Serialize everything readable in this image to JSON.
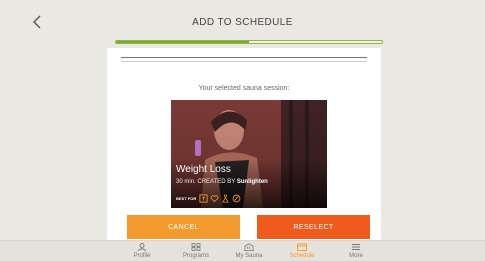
{
  "header": {
    "title": "ADD TO SCHEDULE",
    "progress": 0.5
  },
  "card": {
    "selected_label": "Your selected sauna session:",
    "session": {
      "name": "Weight Loss",
      "duration": "30 min.",
      "created_by_label": "CREATED BY",
      "creator": "Sunlighten",
      "best_for_label": "BEST FOR",
      "best_for_icons": [
        "fitness-icon",
        "heart-icon",
        "body-icon",
        "leaf-icon"
      ]
    }
  },
  "buttons": {
    "cancel": "CANCEL",
    "reselect": "RESELECT"
  },
  "tabbar": {
    "items": [
      {
        "label": "Profile",
        "icon": "person-icon"
      },
      {
        "label": "Programs",
        "icon": "grid-icon"
      },
      {
        "label": "My Sauna",
        "icon": "sauna-icon"
      },
      {
        "label": "Schedule",
        "icon": "calendar-icon",
        "active": true
      },
      {
        "label": "More",
        "icon": "menu-icon"
      }
    ]
  },
  "colors": {
    "accent": "#f39a2e",
    "reselect": "#ef5a1f",
    "progress": "#7fa937"
  }
}
